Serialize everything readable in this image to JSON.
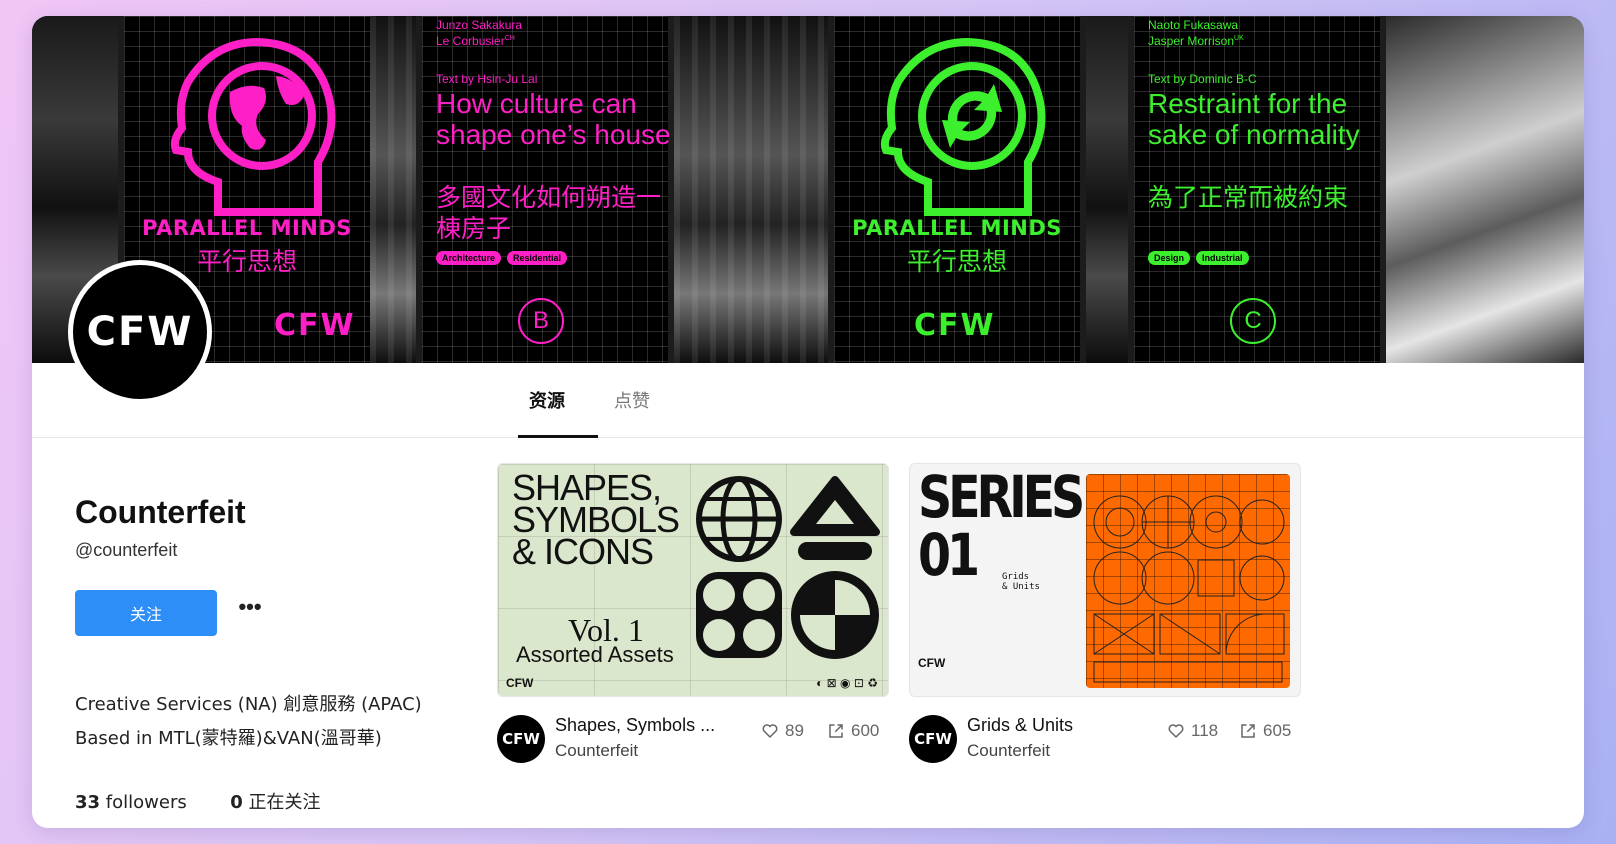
{
  "banner": {
    "poster1": {
      "title": "PARALLEL MINDS",
      "subtitle": "平行思想",
      "mark": "CFW"
    },
    "poster2": {
      "credit_line1": "Junzo Sakakura",
      "credit_line2": "Le Corbusier",
      "credit_sup": "CH",
      "text_by": "Text by Hsin-Ju Lai",
      "headline": "How culture can shape one’s house",
      "headline_cn": "多國文化如何朔造一棟房子",
      "tags": [
        "Architecture",
        "Residential"
      ],
      "letter": "B"
    },
    "poster3": {
      "title": "PARALLEL MINDS",
      "subtitle": "平行思想",
      "mark": "CFW"
    },
    "poster4": {
      "credit_line1": "Naoto Fukasawa",
      "credit_line2": "Jasper Morrison",
      "credit_sup": "UK",
      "text_by": "Text by Dominic B-C",
      "headline": "Restraint for the sake of normality",
      "headline_cn": "為了正常而被約束",
      "tags": [
        "Design",
        "Industrial"
      ],
      "letter": "C"
    },
    "colors": {
      "pink": "#ff1fc7",
      "green": "#3df02e"
    }
  },
  "avatar": {
    "mark": "CFW"
  },
  "tabs": [
    {
      "label": "资源",
      "active": true
    },
    {
      "label": "点赞",
      "active": false
    }
  ],
  "profile": {
    "name": "Counterfeit",
    "handle": "@counterfeit",
    "follow_label": "关注",
    "more_label": "•••",
    "bio_line1": "Creative Services (NA) 創意服務 (APAC)",
    "bio_line2": "Based in MTL(蒙特羅)&VAN(溫哥華)",
    "followers_count": "33",
    "followers_label": "followers",
    "following_count": "0",
    "following_label": "正在关注"
  },
  "cards": [
    {
      "title": "Shapes, Symbols ...",
      "author": "Counterfeit",
      "likes": "89",
      "shares": "600",
      "thumb": {
        "heading_line1": "SHAPES,",
        "heading_line2": "SYMBOLS",
        "heading_line3": "& ICONS",
        "vol": "Vol. 1",
        "assets": "Assorted Assets",
        "foot": "CFW"
      }
    },
    {
      "title": "Grids & Units",
      "author": "Counterfeit",
      "likes": "118",
      "shares": "605",
      "thumb": {
        "heading_line1": "SERIES",
        "heading_line2": "01",
        "sub_line1": "Grids",
        "sub_line2": "& Units",
        "foot": "CFW"
      }
    }
  ],
  "accent_color": "#2d8ef7"
}
